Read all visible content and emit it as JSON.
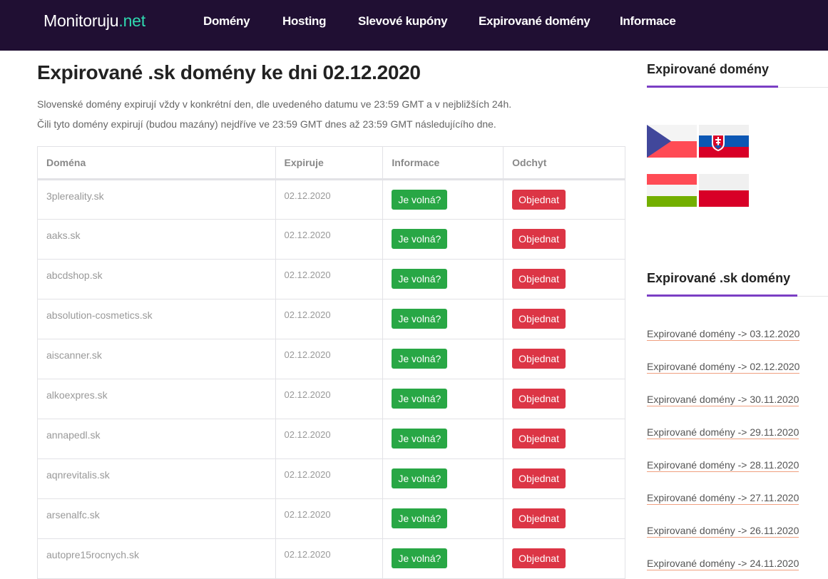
{
  "header": {
    "logo_main": "Monitoruju",
    "logo_tld": ".net",
    "nav": [
      {
        "label": "Domény"
      },
      {
        "label": "Hosting"
      },
      {
        "label": "Slevové kupóny"
      },
      {
        "label": "Expirované domény"
      },
      {
        "label": "Informace"
      }
    ]
  },
  "main": {
    "title": "Expirované .sk domény ke dni 02.12.2020",
    "intro_line1": "Slovenské domény expirují vždy v konkrétní den, dle uvedeného datumu ve 23:59 GMT a v nejbližších 24h.",
    "intro_line2": "Čili tyto domény expirují (budou mazány) nejdříve ve 23:59 GMT dnes až 23:59 GMT následujícího dne.",
    "table": {
      "headers": [
        "Doména",
        "Expiruje",
        "Informace",
        "Odchyt"
      ],
      "check_label": "Je volná?",
      "order_label": "Objednat",
      "rows": [
        {
          "domain": "3plereality.sk",
          "expires": "02.12.2020"
        },
        {
          "domain": "aaks.sk",
          "expires": "02.12.2020"
        },
        {
          "domain": "abcdshop.sk",
          "expires": "02.12.2020"
        },
        {
          "domain": "absolution-cosmetics.sk",
          "expires": "02.12.2020"
        },
        {
          "domain": "aiscanner.sk",
          "expires": "02.12.2020"
        },
        {
          "domain": "alkoexpres.sk",
          "expires": "02.12.2020"
        },
        {
          "domain": "annapedl.sk",
          "expires": "02.12.2020"
        },
        {
          "domain": "aqnrevitalis.sk",
          "expires": "02.12.2020"
        },
        {
          "domain": "arsenalfc.sk",
          "expires": "02.12.2020"
        },
        {
          "domain": "autopre15rocnych.sk",
          "expires": "02.12.2020"
        }
      ]
    }
  },
  "sidebar": {
    "widget1_title": "Expirované domény",
    "flags": [
      {
        "name": "czech-flag",
        "country": "CZ"
      },
      {
        "name": "slovakia-flag",
        "country": "SK"
      },
      {
        "name": "hungary-flag",
        "country": "HU"
      },
      {
        "name": "poland-flag",
        "country": "PL"
      }
    ],
    "widget2_title": "Expirované .sk domény",
    "links": [
      "Expirované domény -> 03.12.2020",
      "Expirované domény -> 02.12.2020",
      "Expirované domény -> 30.11.2020",
      "Expirované domény -> 29.11.2020",
      "Expirované domény -> 28.11.2020",
      "Expirované domény -> 27.11.2020",
      "Expirované domény -> 26.11.2020",
      "Expirované domény -> 24.11.2020"
    ]
  },
  "colors": {
    "header_bg": "#200f33",
    "logo_accent": "#2fd9b0",
    "accent_purple": "#7b3fc4",
    "button_green": "#28a745",
    "button_red": "#dc3545",
    "link_underline": "#f0a080"
  }
}
